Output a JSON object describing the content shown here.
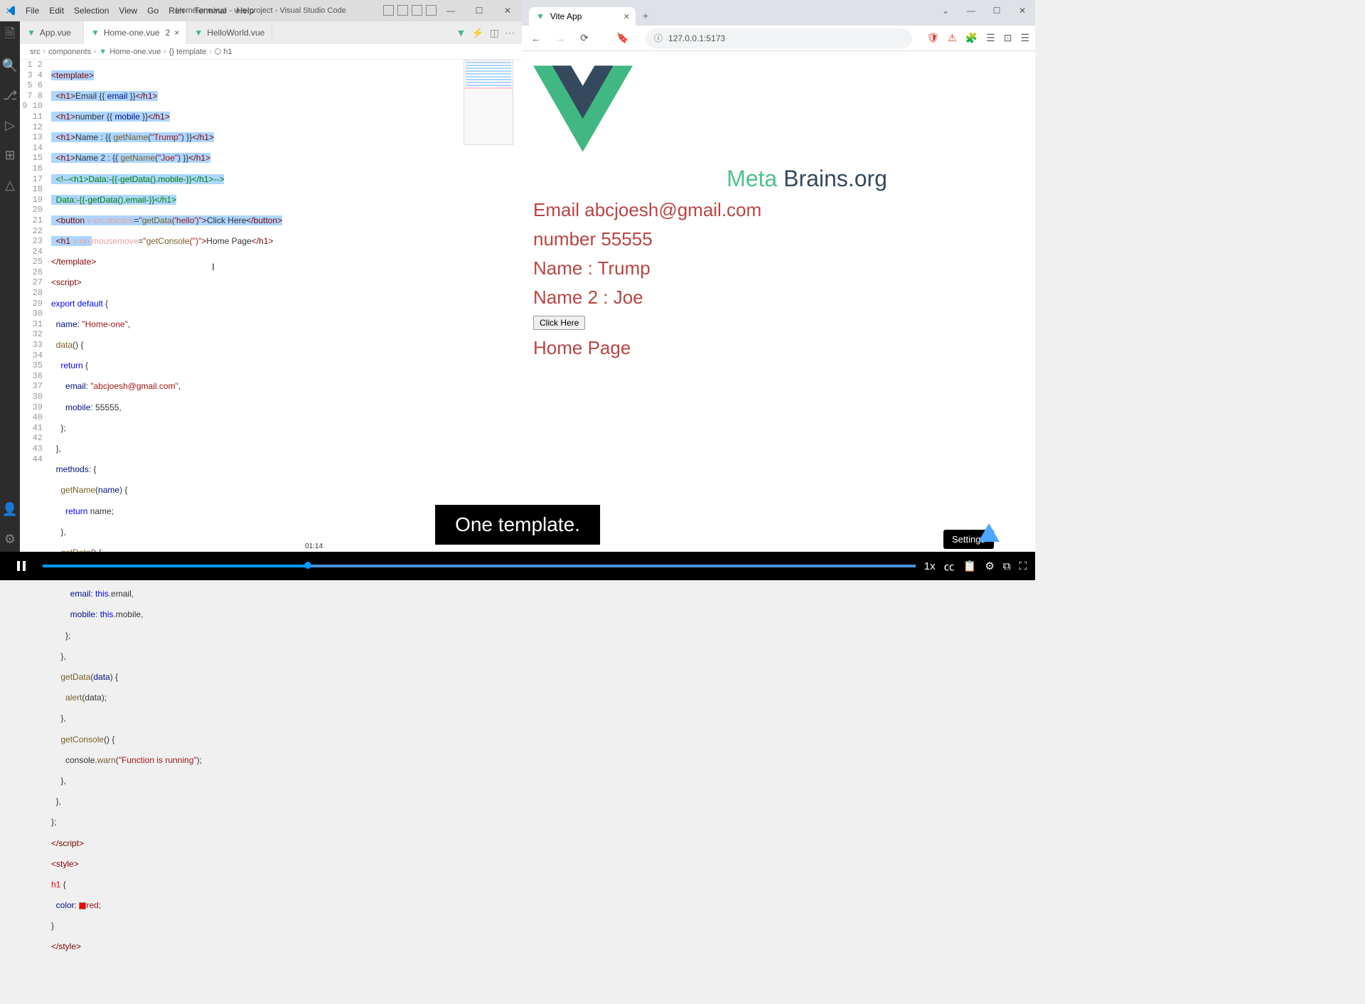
{
  "vscode": {
    "title": "Home-one.vue - vue-project - Visual Studio Code",
    "menu": [
      "File",
      "Edit",
      "Selection",
      "View",
      "Go",
      "Run",
      "Terminal",
      "Help"
    ],
    "tabs": [
      {
        "label": "App.vue",
        "active": false,
        "modified": false
      },
      {
        "label": "Home-one.vue",
        "active": true,
        "modified": true,
        "badge": "2"
      },
      {
        "label": "HelloWorld.vue",
        "active": false,
        "modified": false
      }
    ],
    "breadcrumb": [
      "src",
      "components",
      "Home-one.vue",
      "{} template",
      "⬡ h1"
    ],
    "code_values": {
      "email_text": "Email",
      "number_text": "number",
      "name_label": "Name :",
      "name2_label": "Name 2 :",
      "getname_arg1": "\"Trump\"",
      "getname_arg2": "\"Joe\"",
      "getdata_arg": "'hello'",
      "button_text": "Click Here",
      "home_text": "Home Page",
      "component_name": "\"Home-one\"",
      "email_value": "\"abcjoesh@gmail.com\"",
      "mobile_value": "55555",
      "console_msg": "\"Function is running\"",
      "color_val": "red"
    }
  },
  "browser": {
    "tab_title": "Vite App",
    "url": "127.0.0.1:5173",
    "brand_part1": "Meta ",
    "brand_part2": "Brains.org",
    "line_email": "Email abcjoesh@gmail.com",
    "line_number": "number 55555",
    "line_name": "Name : Trump",
    "line_name2": "Name 2 : Joe",
    "button": "Click Here",
    "line_home": "Home Page"
  },
  "video": {
    "caption": "One template.",
    "timestamp": "01:14",
    "tooltip": "Settings"
  }
}
